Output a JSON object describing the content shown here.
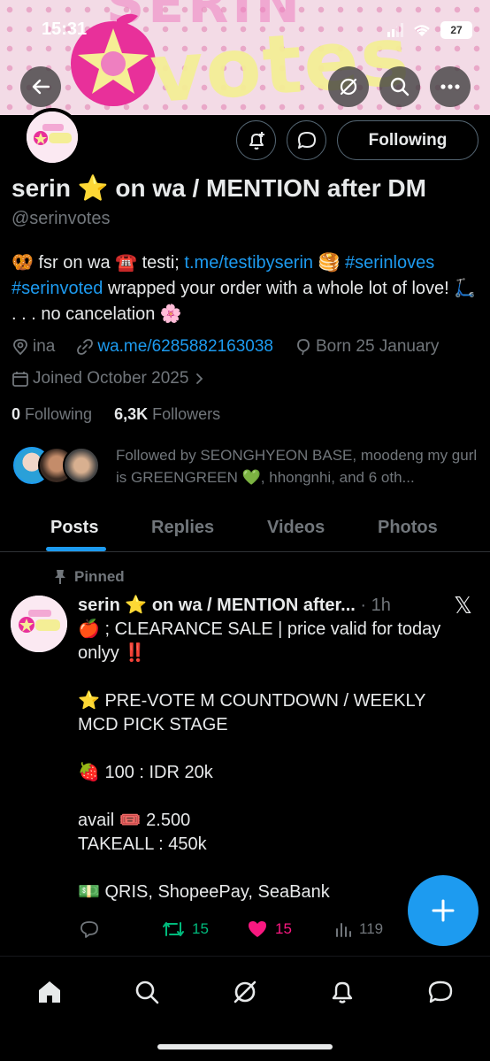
{
  "status_bar": {
    "time": "15:31",
    "battery": "27"
  },
  "banner": {
    "text_top": "SERIN",
    "text_main": "votes"
  },
  "header_buttons": [
    "back-icon",
    "grok-icon",
    "search-icon",
    "more-icon"
  ],
  "profile": {
    "display_name": "serin ⭐ on wa / MENTION after DM",
    "handle": "@serinvotes",
    "follow_label": "Following",
    "bio": {
      "p1": "🥨 fsr on wa ☎️ testi; ",
      "link1": "t.me/testibyserin",
      "p2": " 🥞 ",
      "tag1": "#serinloves",
      "tag2": "#serinvoted",
      "p3": " wrapped your order with a whole lot of love! 🛴 . . . no cancelation 🌸"
    },
    "location": "ina",
    "website": "wa.me/6285882163038",
    "birthday": "Born 25 January",
    "joined": "Joined October 2025",
    "following_count": "0",
    "following_label": "Following",
    "followers_count": "6,3K",
    "followers_label": "Followers",
    "followed_by": "Followed by SEONGHYEON BASE, moodeng my gurl is GREENGREEN 💚, hhongnhi, and 6 oth..."
  },
  "tabs": [
    {
      "label": "Posts"
    },
    {
      "label": "Replies"
    },
    {
      "label": "Videos"
    },
    {
      "label": "Photos"
    }
  ],
  "post": {
    "pinned_label": "Pinned",
    "author": "serin ⭐ on wa / MENTION after...",
    "time": "· 1h",
    "body": "🍎 ; CLEARANCE SALE | price valid for today onlyy ‼️\n\n⭐ PRE-VOTE M COUNTDOWN / WEEKLY MCD PICK STAGE\n\n🍓 100 : IDR 20k\n\navail 🎟️ 2.500\nTAKEALL : 450k\n\n💵 QRIS, ShopeePay, SeaBank",
    "retweets": "15",
    "likes": "15",
    "views": "119"
  },
  "colors": {
    "accent": "#1d9bf0",
    "like": "#f91880",
    "retweet": "#00ba7c",
    "muted": "#71767b"
  }
}
